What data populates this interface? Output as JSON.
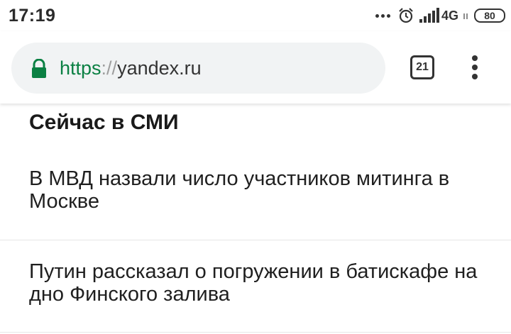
{
  "status_bar": {
    "time": "17:19",
    "network": "4G",
    "battery": "80",
    "icons": [
      "dots-icon",
      "alarm-icon",
      "signal-icon",
      "battery-icon"
    ]
  },
  "browser": {
    "url_scheme": "https",
    "url_separator": "://",
    "url_host": "yandex.ru",
    "tab_count": "21",
    "secure_color": "#0b8043",
    "icons": [
      "lock-icon",
      "tabs-icon",
      "menu-icon"
    ]
  },
  "section": {
    "title": "Сейчас в СМИ",
    "news": [
      {
        "text": "В МВД назвали число участников митинга в Москве"
      },
      {
        "text": "Путин рассказал о погружении в батискафе на дно Финского залива"
      }
    ]
  }
}
